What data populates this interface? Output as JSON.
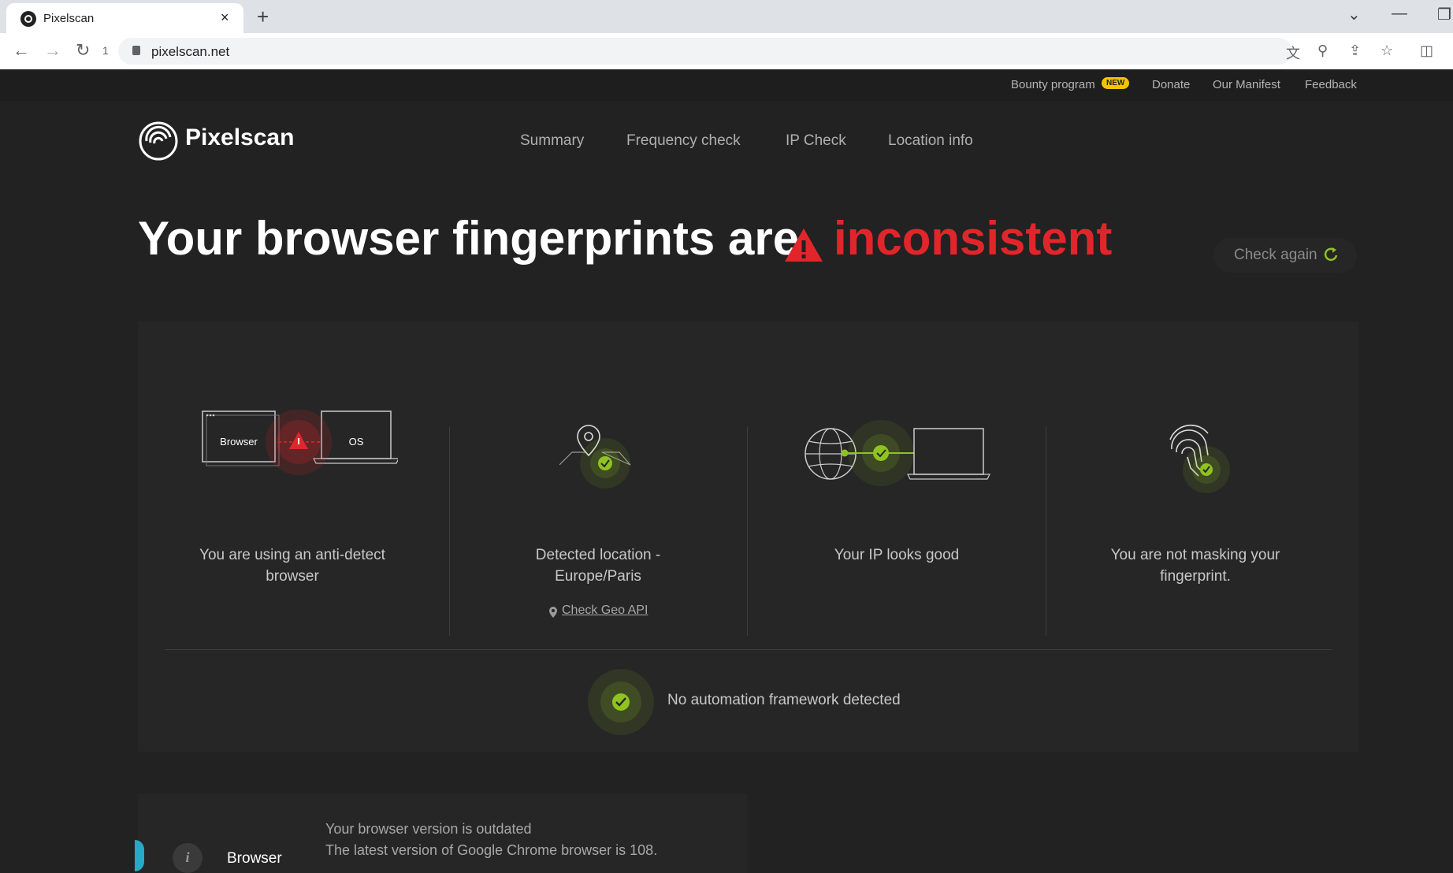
{
  "browser": {
    "tab_title": "Pixelscan",
    "tab_close": "×",
    "new_tab": "+",
    "url": "pixelscan.net",
    "tab_count": "1",
    "window_controls": [
      "⌄",
      "—",
      "❐"
    ],
    "icons": [
      "back-icon",
      "forward-icon",
      "reload-icon",
      "lock-icon",
      "translate-icon",
      "zoom-icon",
      "share-icon",
      "star-icon",
      "sidepanel-icon"
    ]
  },
  "topbar": {
    "bounty": "Bounty program",
    "bounty_badge": "NEW",
    "donate": "Donate",
    "manifest": "Our Manifest",
    "feedback": "Feedback"
  },
  "header": {
    "logo": "Pixelscan",
    "nav": [
      "Summary",
      "Frequency check",
      "IP Check",
      "Location info"
    ]
  },
  "hero": {
    "title": "Your browser fingerprints are",
    "status": "inconsistent",
    "check_again": "Check again"
  },
  "cards": {
    "browser_label": "Browser",
    "os_label": "OS",
    "antidetect_line1": "You are using an anti-detect",
    "antidetect_line2": "browser",
    "location_line1": "Detected location -",
    "location_line2": "Europe/Paris",
    "geo_link": "Check Geo API",
    "ip": "Your IP looks good",
    "mask_line1": "You are not masking your",
    "mask_line2": "fingerprint.",
    "automation": "No automation framework detected"
  },
  "detail": {
    "label": "Browser",
    "line1": "Your browser version is outdated",
    "line2": "The latest version of Google Chrome browser is 108."
  },
  "colors": {
    "background": "#222222",
    "panel": "#262626",
    "accent_green": "#8fc31f",
    "danger_red": "#e0262b",
    "badge_yellow": "#f5c400",
    "cyan": "#27a9c8"
  }
}
